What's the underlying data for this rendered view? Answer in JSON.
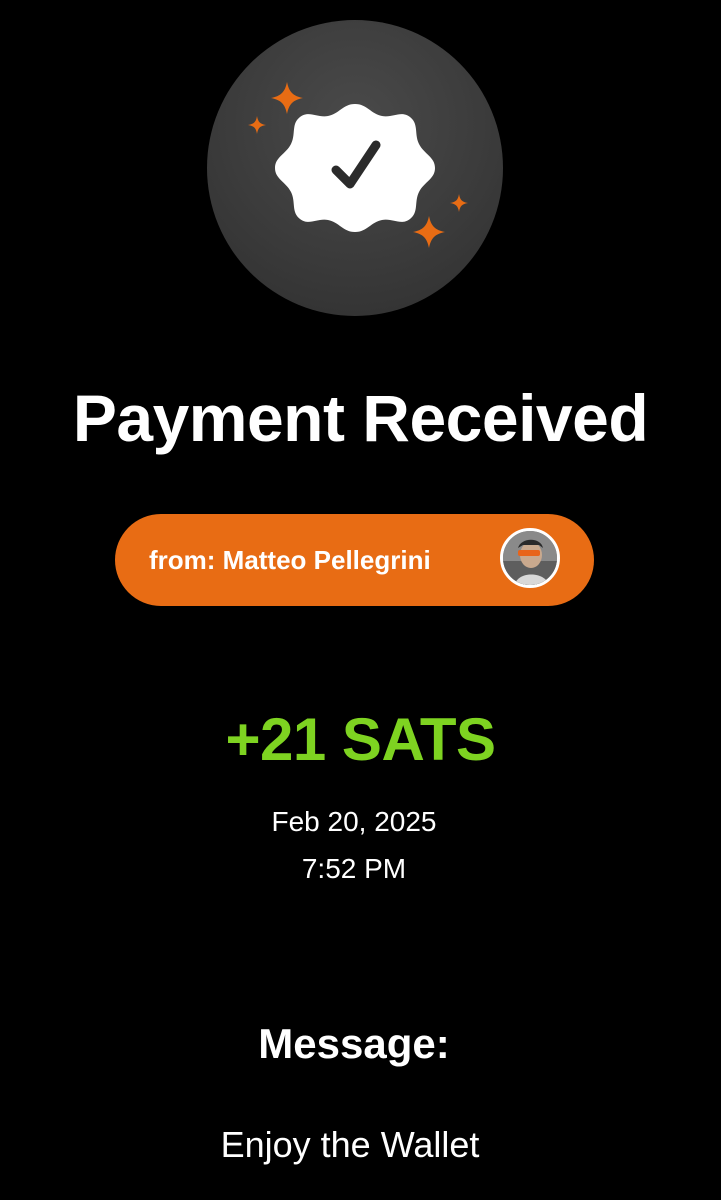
{
  "header": {
    "badge_icon": "verified-check-badge-icon",
    "sparkle_icon": "sparkle-icon",
    "accent_color": "#e86c14"
  },
  "payment": {
    "title": "Payment Received",
    "sender_label": "from: Matteo Pellegrini",
    "sender_avatar": "avatar-photo",
    "amount": "+21 SATS",
    "amount_color": "#7ed321",
    "date": "Feb 20, 2025",
    "time": "7:52 PM"
  },
  "message": {
    "label": "Message:",
    "text": "Enjoy the Wallet"
  }
}
